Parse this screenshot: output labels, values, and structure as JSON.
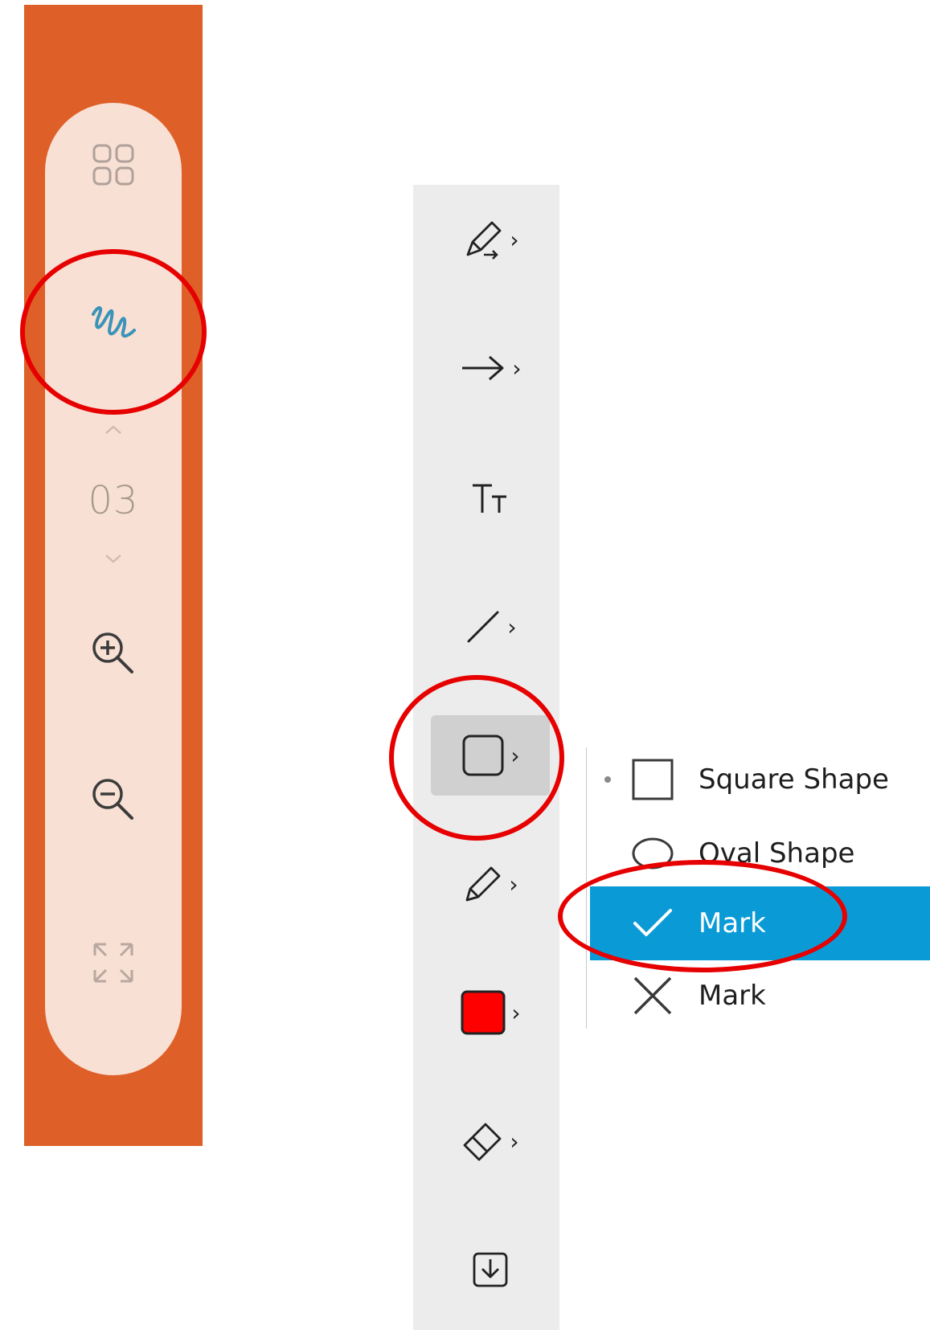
{
  "side_panel": {
    "page_number": "03",
    "items": [
      {
        "name": "grid-view",
        "icon": "grid-icon"
      },
      {
        "name": "ink",
        "icon": "squiggle-pen-icon",
        "accent_color": "#3a93b9"
      },
      {
        "name": "page-up",
        "icon": "chevron-up-icon"
      },
      {
        "name": "page-down",
        "icon": "chevron-down-icon"
      },
      {
        "name": "zoom-in",
        "icon": "zoom-in-icon"
      },
      {
        "name": "zoom-out",
        "icon": "zoom-out-icon"
      },
      {
        "name": "fullscreen",
        "icon": "expand-icon"
      }
    ],
    "panel_color": "#de5f27",
    "pill_color": "#f8e0d4"
  },
  "toolbar": {
    "tools": [
      {
        "name": "highlighter-pen",
        "icon": "highlighter-icon",
        "chevron": "›"
      },
      {
        "name": "arrow",
        "icon": "arrow-right-icon",
        "chevron": "›"
      },
      {
        "name": "text",
        "icon": "text-size-icon"
      },
      {
        "name": "line",
        "icon": "line-icon",
        "chevron": "›"
      },
      {
        "name": "shape",
        "icon": "square-shape-icon",
        "chevron": "›",
        "selected": true
      },
      {
        "name": "pen",
        "icon": "pen-icon",
        "chevron": "›"
      },
      {
        "name": "color",
        "icon": "color-swatch-icon",
        "chevron": "›",
        "color": "#ff0000"
      },
      {
        "name": "eraser",
        "icon": "eraser-icon",
        "chevron": "›"
      },
      {
        "name": "save",
        "icon": "download-icon"
      }
    ]
  },
  "shape_menu": {
    "items": [
      {
        "label": "Square Shape",
        "icon": "square-icon",
        "current": true
      },
      {
        "label": "Oval Shape",
        "icon": "oval-icon"
      },
      {
        "label": "Mark",
        "icon": "checkmark-icon",
        "highlighted": true
      },
      {
        "label": "Mark",
        "icon": "x-mark-icon"
      }
    ],
    "highlight_color": "#0a9bd7"
  },
  "annotation_color": "#e60000"
}
